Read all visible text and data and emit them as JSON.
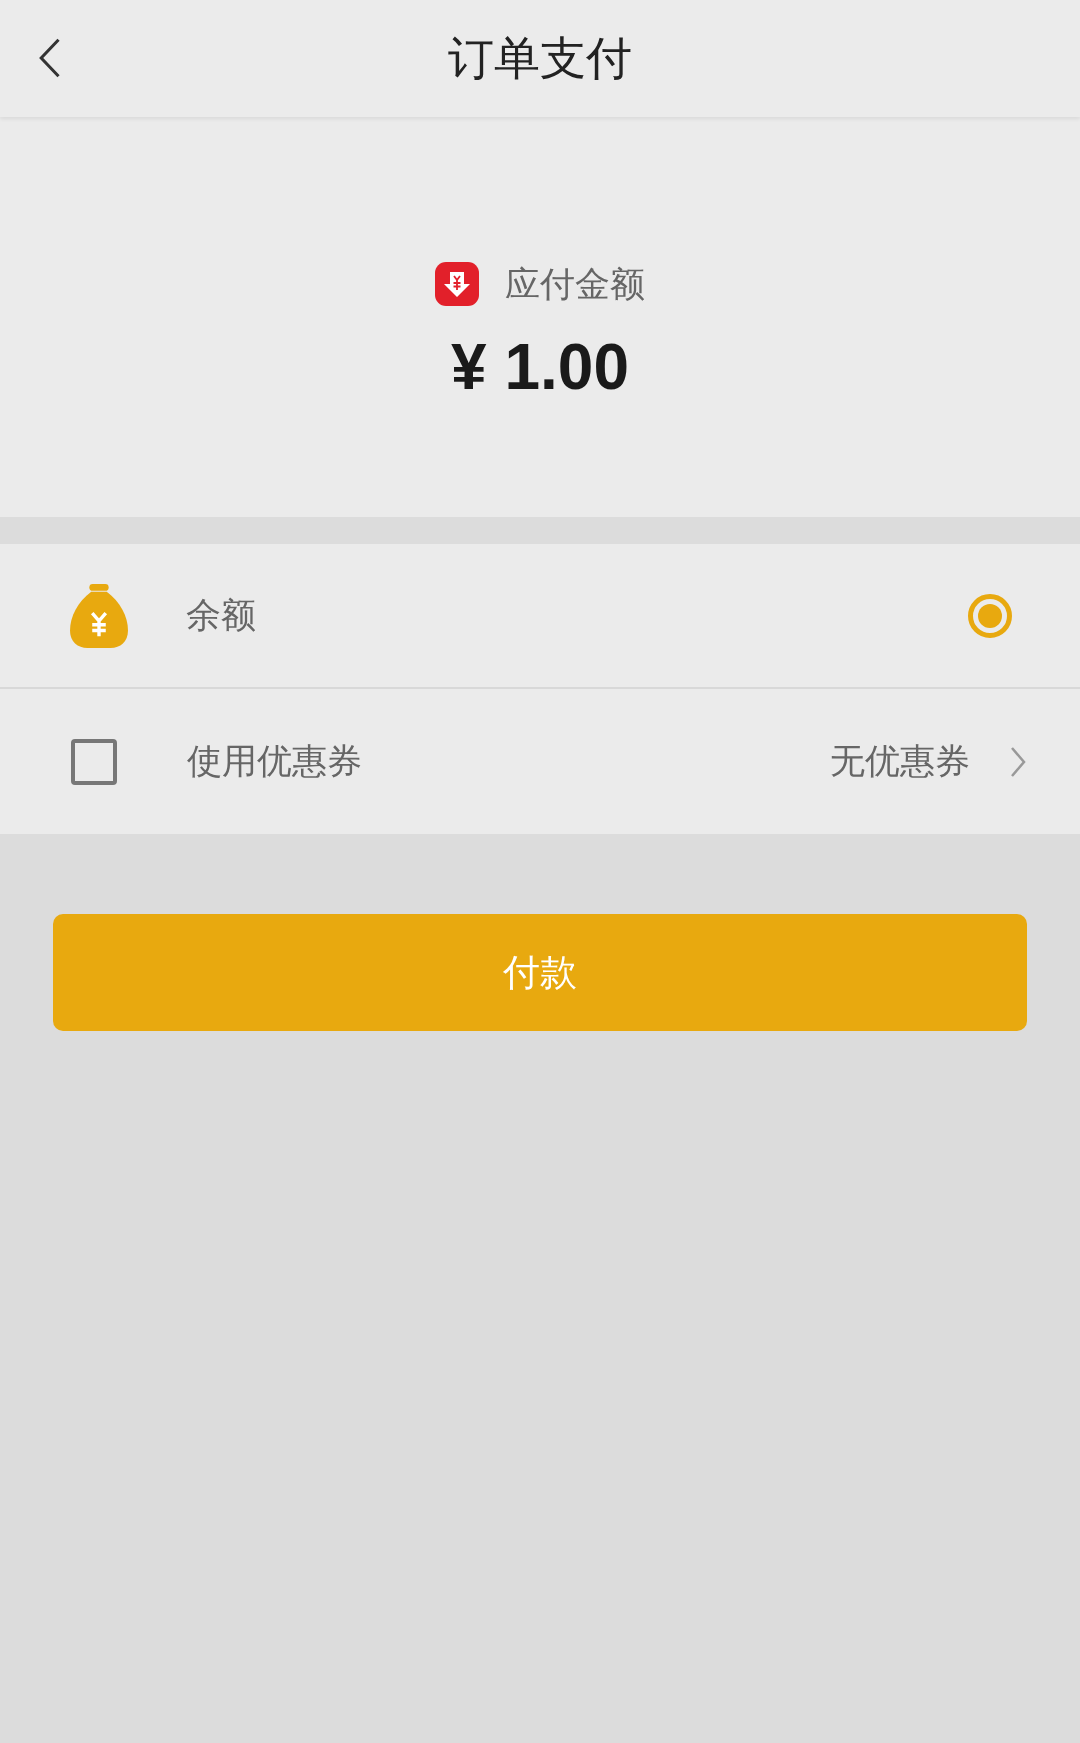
{
  "header": {
    "title": "订单支付"
  },
  "amount": {
    "label": "应付金额",
    "value": "¥ 1.00"
  },
  "payment_method": {
    "label": "余额",
    "selected": true
  },
  "coupon": {
    "label": "使用优惠券",
    "checked": false,
    "value": "无优惠券"
  },
  "pay_button": {
    "label": "付款"
  }
}
